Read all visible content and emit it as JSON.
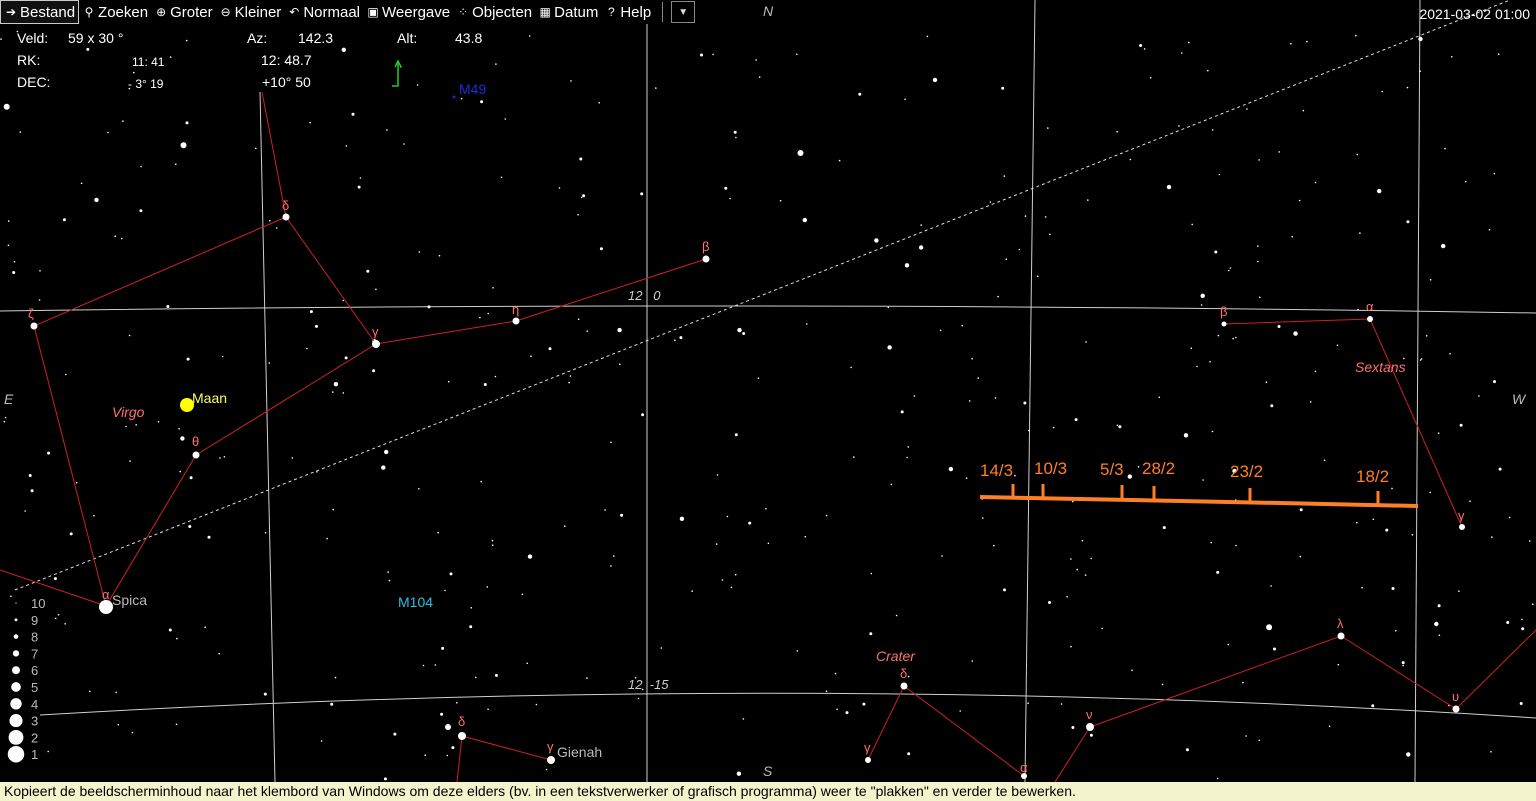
{
  "menu": {
    "items": [
      {
        "label": "Bestand",
        "icon": "arrow-icon"
      },
      {
        "label": "Zoeken",
        "icon": "binoculars-icon"
      },
      {
        "label": "Groter",
        "icon": "zoom-in-icon"
      },
      {
        "label": "Kleiner",
        "icon": "zoom-out-icon"
      },
      {
        "label": "Normaal",
        "icon": "undo-icon"
      },
      {
        "label": "Weergave",
        "icon": "monitor-icon"
      },
      {
        "label": "Objecten",
        "icon": "stars-icon"
      },
      {
        "label": "Datum",
        "icon": "calendar-icon"
      },
      {
        "label": "Help",
        "icon": "help-icon"
      }
    ],
    "dropdown_symbol": "▼"
  },
  "datetime": "2021-03-02  01:00",
  "info": {
    "veld_label": "Veld:",
    "veld_value": "59  x    30 °",
    "rk_label": "RK:",
    "rk_left": "11: 41",
    "rk_right": "12: 48.7",
    "dec_label": "DEC:",
    "dec_left": "- 3° 19",
    "dec_right": "+10° 50",
    "az_label": "Az:",
    "az_value": "142.3",
    "alt_label": "Alt:",
    "alt_value": "43.8"
  },
  "compass": {
    "n": "N",
    "s": "S",
    "e": "E",
    "w": "W"
  },
  "grid_labels": {
    "ra_upper": "12   0",
    "ra_lower": "12  -15"
  },
  "constellations": {
    "virgo": "Virgo",
    "sextans": "Sextans",
    "crater": "Crater"
  },
  "greek": {
    "virgo_delta": "δ",
    "virgo_zeta": "ζ",
    "virgo_gamma": "γ",
    "virgo_eta": "η",
    "virgo_beta": "β",
    "virgo_theta": "θ",
    "virgo_alpha": "α",
    "sextans_beta": "β",
    "sextans_alpha": "α",
    "sextans_gamma": "γ",
    "crater_delta": "δ",
    "crater_gamma": "γ",
    "crater_alpha": "α",
    "hydra_nu": "ν",
    "hydra_lambda": "λ",
    "hydra_upsilon": "υ",
    "corvus_delta": "δ",
    "corvus_gamma": "γ"
  },
  "objects": {
    "moon": "Maan",
    "spica": "Spica",
    "gienah": "Gienah",
    "m49": "M49",
    "m104": "M104"
  },
  "track": {
    "dates": [
      "14/3",
      "10/3",
      "5/3",
      "28/2",
      "23/2",
      "18/2"
    ]
  },
  "magnitude_scale": [
    "10",
    "9",
    "8",
    "7",
    "6",
    "5",
    "4",
    "3",
    "2",
    "1"
  ],
  "colors": {
    "constellation": "#cc2222",
    "label_red": "#ff7070",
    "track": "#ff7f27",
    "moon": "#ffff00",
    "m49": "#1c2bd8",
    "m104": "#29c0e0",
    "grid": "#cfcfcf"
  },
  "statusbar": "Kopieert de beeldscherminhoud naar het klembord van Windows om deze elders (bv. in een tekstverwerker of grafisch programma) weer te \"plakken\" en verder te bewerken."
}
